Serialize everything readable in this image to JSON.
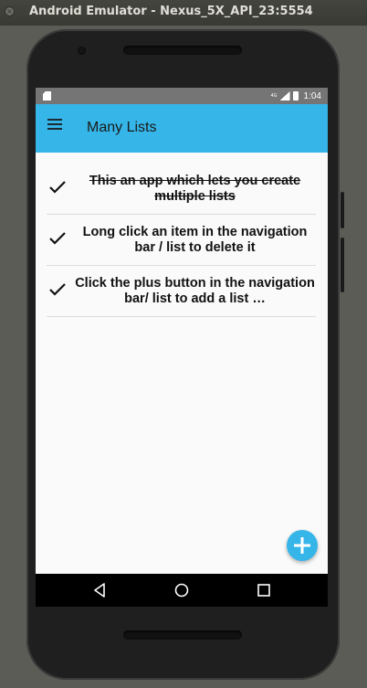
{
  "window": {
    "title": "Android Emulator - Nexus_5X_API_23:5554",
    "close_glyph": "×"
  },
  "statusbar": {
    "network_label": "4G",
    "time": "1:04"
  },
  "appbar": {
    "title": "Many Lists"
  },
  "list": {
    "items": [
      {
        "label": "This an app which lets you create multiple lists",
        "checked": true,
        "strikethrough": true
      },
      {
        "label": "Long click an item in the navigation bar / list to delete it",
        "checked": true,
        "strikethrough": false
      },
      {
        "label": "Click the plus button in the navigation bar/ list to add a list …",
        "checked": true,
        "strikethrough": false
      }
    ]
  },
  "colors": {
    "accent": "#35b5e8",
    "status_bar": "#757575",
    "nav_bar": "#000000",
    "screen_bg": "#fafafa"
  },
  "icons": {
    "menu": "hamburger-menu-icon",
    "check": "checkmark-icon",
    "fab": "plus-icon",
    "nav_back": "back-triangle-icon",
    "nav_home": "home-circle-icon",
    "nav_recents": "recents-square-icon"
  }
}
